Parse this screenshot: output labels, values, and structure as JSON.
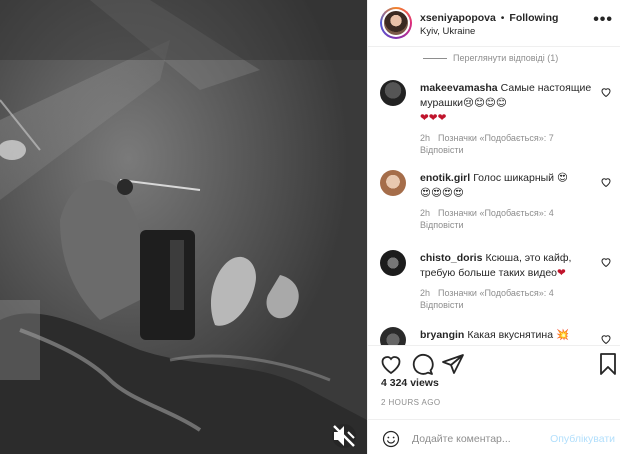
{
  "colors": {
    "text": "#262626",
    "muted": "#8e8e8e",
    "border": "#efefef",
    "post_disabled": "#b2dffc",
    "heart_red": "#c0142c"
  },
  "media": {
    "type": "video",
    "mute_icon": "speaker-muted-icon"
  },
  "header": {
    "username": "xseniyapopova",
    "separator": "•",
    "follow_status": "Following",
    "location": "Kyiv, Ukraine",
    "more_icon": "ellipsis-icon"
  },
  "view_replies": "Переглянути відповіді (1)",
  "comments": [
    {
      "username": "makeevamasha",
      "text": "Самые настоящие мурашки😢😊😊😊",
      "hearts": "❤❤❤",
      "time": "2h",
      "likes": "Позначки «Подобається»: 7",
      "reply": "Відповісти"
    },
    {
      "username": "enotik.girl",
      "text": "Голос шикарный 😍",
      "hearts": "😍😍😍😍",
      "time": "2h",
      "likes": "Позначки «Подобається»: 4",
      "reply": "Відповісти"
    },
    {
      "username": "chisto_doris",
      "text": "Ксюша, это кайф, требую больше таких видео",
      "hearts": "❤",
      "time": "2h",
      "likes": "Позначки «Подобається»: 4",
      "reply": "Відповісти"
    },
    {
      "username": "bryangin",
      "text": "Какая вкуснятина 💥",
      "hearts": "",
      "time": "",
      "likes": "",
      "reply": ""
    }
  ],
  "actions": {
    "like_icon": "heart-icon",
    "comment_icon": "comment-icon",
    "share_icon": "paper-plane-icon",
    "save_icon": "bookmark-icon"
  },
  "views": "4 324 views",
  "posted_ago": "2 HOURS AGO",
  "add_comment": {
    "emoji_icon": "smiley-icon",
    "placeholder": "Додайте коментар...",
    "post_label": "Опублікувати"
  }
}
